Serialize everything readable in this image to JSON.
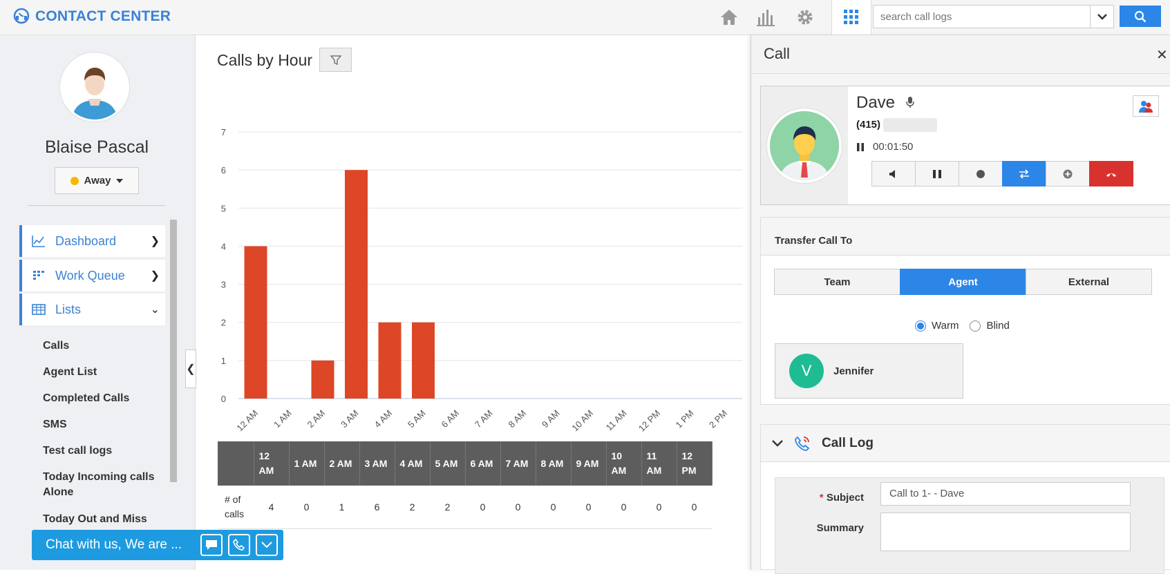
{
  "app": {
    "title": "CONTACT CENTER"
  },
  "search": {
    "placeholder": "search call logs"
  },
  "user": {
    "name": "Blaise Pascal",
    "status": "Away"
  },
  "nav": {
    "items": [
      {
        "label": "Dashboard"
      },
      {
        "label": "Work Queue"
      },
      {
        "label": "Lists"
      }
    ],
    "sub_items": [
      "Calls",
      "Agent List",
      "Completed Calls",
      "SMS",
      "Test call logs",
      "Today Incoming calls Alone",
      "Today Out and Miss"
    ]
  },
  "chat": {
    "label": "Chat with us, We are ..."
  },
  "main": {
    "title": "Calls by Hour"
  },
  "chart_data": {
    "type": "bar",
    "categories": [
      "12 AM",
      "1 AM",
      "2 AM",
      "3 AM",
      "4 AM",
      "5 AM",
      "6 AM",
      "7 AM",
      "8 AM",
      "9 AM",
      "10 AM",
      "11 AM",
      "12 PM",
      "1 PM",
      "2 PM"
    ],
    "values": [
      4,
      0,
      1,
      6,
      2,
      2,
      0,
      0,
      0,
      0,
      0,
      0,
      0,
      0,
      0
    ],
    "yticks": [
      "0",
      "1",
      "2",
      "3",
      "4",
      "5",
      "6",
      "7"
    ],
    "ylim": [
      0,
      7
    ],
    "color": "#dd4727",
    "grid": true
  },
  "table": {
    "row_header": "# of calls",
    "columns": [
      "12 AM",
      "1 AM",
      "2 AM",
      "3 AM",
      "4 AM",
      "5 AM",
      "6 AM",
      "7 AM",
      "8 AM",
      "9 AM",
      "10 AM",
      "11 AM",
      "12 PM"
    ],
    "values": [
      "4",
      "0",
      "1",
      "6",
      "2",
      "2",
      "0",
      "0",
      "0",
      "0",
      "0",
      "0",
      "0"
    ]
  },
  "call": {
    "panel_title": "Call",
    "caller_name": "Dave",
    "caller_phone": "(415)",
    "timer": "00:01:50"
  },
  "transfer": {
    "heading": "Transfer Call To",
    "tabs": [
      "Team",
      "Agent",
      "External"
    ],
    "active_tab": "Agent",
    "modes": [
      "Warm",
      "Blind"
    ],
    "selected_mode": "Warm",
    "agent": {
      "initial": "V",
      "name": "Jennifer"
    }
  },
  "call_log": {
    "title": "Call Log",
    "subject_label": "Subject",
    "subject_value": "Call to 1-            - Dave",
    "summary_label": "Summary"
  },
  "colors": {
    "accent": "#2b86e8",
    "bar": "#dd4727",
    "hangup": "#d9322e",
    "agent_avatar": "#1fbc94"
  }
}
